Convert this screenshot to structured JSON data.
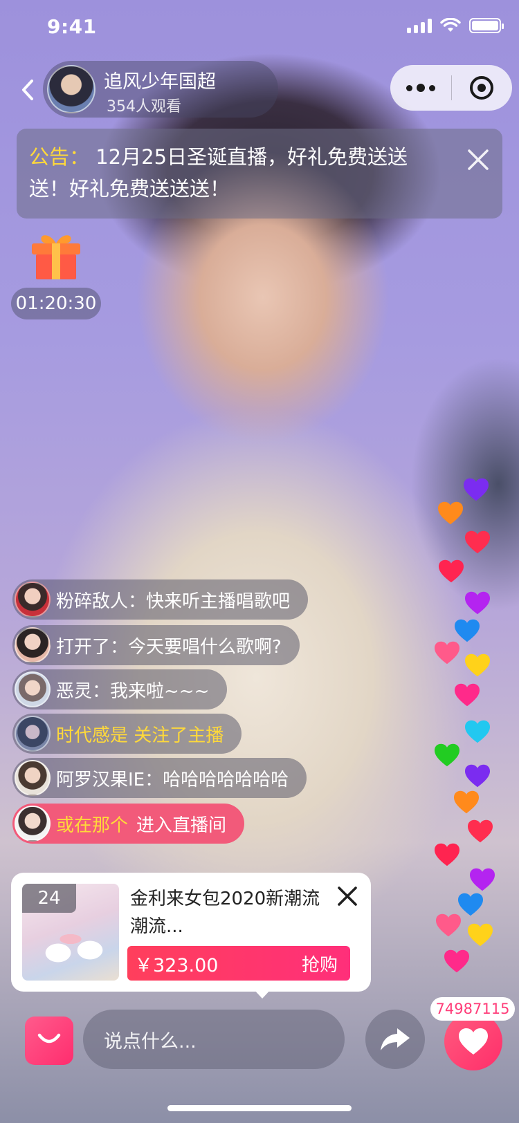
{
  "status_bar": {
    "time": "9:41"
  },
  "header": {
    "host_name": "追风少年国超",
    "viewers": "354人观看"
  },
  "notice": {
    "label": "公告：",
    "text": "12月25日圣诞直播，好礼免费送送送！好礼免费送送送！"
  },
  "gift": {
    "timer": "01:20:30"
  },
  "comments": [
    {
      "name": "粉碎敌人",
      "text": "：快来听主播唱歌吧"
    },
    {
      "name": "打开了",
      "text": "：今天要唱什么歌啊?"
    },
    {
      "name": "恶灵",
      "text": "：我来啦~~~"
    },
    {
      "text": "时代感是 关注了主播"
    },
    {
      "name": "阿罗汉果IE",
      "text": "：哈哈哈哈哈哈哈"
    },
    {
      "name": "或在那个",
      "text": "进入直播间"
    }
  ],
  "product": {
    "badge": "24",
    "title": "金利来女包2020新潮流潮流...",
    "price": "￥323.00",
    "buy_label": "抢购"
  },
  "bottom_bar": {
    "input_placeholder": "说点什么...",
    "like_count": "74987115"
  },
  "colors": {
    "accent_pink": "#ff2f6e",
    "notice_yellow": "#ffd93a"
  },
  "icons": [
    "back-arrow-icon",
    "more-dots-icon",
    "record-circle-icon",
    "close-icon",
    "gift-icon",
    "shopping-bag-icon",
    "share-arrow-icon",
    "heart-icon"
  ]
}
